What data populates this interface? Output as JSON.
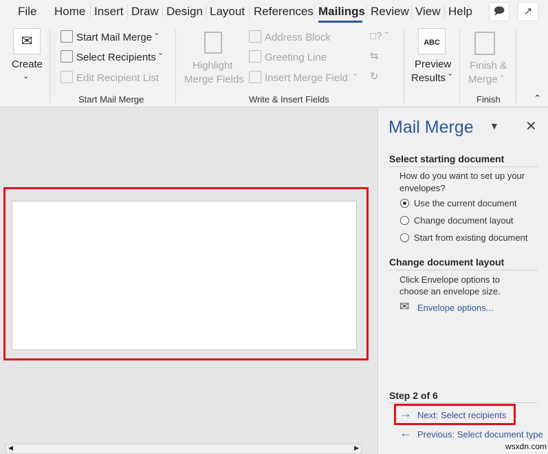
{
  "tabs": [
    "File",
    "Home",
    "Insert",
    "Draw",
    "Design",
    "Layout",
    "References",
    "Mailings",
    "Review",
    "View",
    "Help"
  ],
  "active_tab": "Mailings",
  "ribbon": {
    "create": "Create",
    "start_mail_merge": "Start Mail Merge",
    "select_recipients": "Select Recipients",
    "edit_recipient_list": "Edit Recipient List",
    "group_start": "Start Mail Merge",
    "highlight_1": "Highlight",
    "highlight_2": "Merge Fields",
    "address_block": "Address Block",
    "greeting_line": "Greeting Line",
    "insert_merge_field": "Insert Merge Field",
    "group_write": "Write & Insert Fields",
    "preview_icon_text": "ABC",
    "preview_1": "Preview",
    "preview_2": "Results",
    "finish_1": "Finish &",
    "finish_2": "Merge",
    "group_finish": "Finish"
  },
  "pane": {
    "title": "Mail Merge",
    "h1": "Select starting document",
    "question_1": "How do you want to set up your",
    "question_2": "envelopes?",
    "options": [
      "Use the current document",
      "Change document layout",
      "Start from existing document"
    ],
    "selected": 0,
    "h2": "Change document layout",
    "desc_1": "Click Envelope options to",
    "desc_2": "choose an envelope size.",
    "envelope_link": "Envelope options...",
    "step": "Step 2 of 6",
    "next": "Next: Select recipients",
    "previous": "Previous: Select document type"
  },
  "watermark": "wsxdn.com"
}
